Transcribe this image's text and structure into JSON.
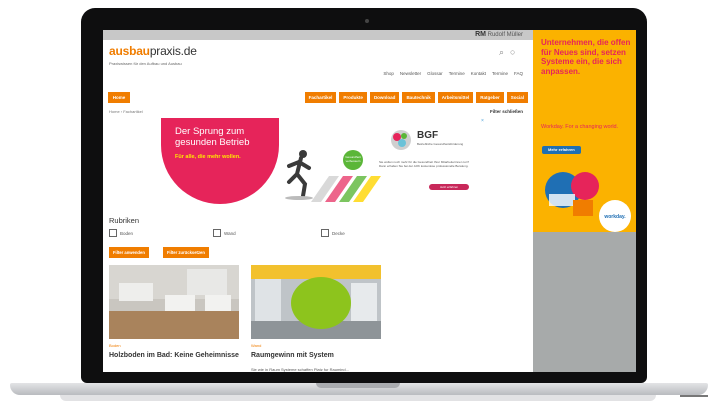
{
  "site": {
    "brand_badge": "RM",
    "brand_badge_sub": "Rudolf Müller",
    "logo_part1": "ausbau",
    "logo_part2": "praxis.de",
    "tagline": "Praxiswissen für den Aufbau und Ausbau",
    "util_nav": [
      "Shop",
      "Newsletter",
      "Glossar",
      "Termine",
      "Kontakt",
      "Termine",
      "FAQ"
    ],
    "nav_home": "Home",
    "nav_items": [
      "Fachartikel",
      "Produkte",
      "Download",
      "Bautechnik",
      "Arbeitsmittel",
      "Ratgeber",
      "Social"
    ],
    "breadcrumb": "Home  ›  Fachartikel",
    "filter_link": "Filter schließen"
  },
  "ad_main": {
    "headline": "Der Sprung zum gesunden Betrieb",
    "sub": "Für alle, die mehr wollen.",
    "badge": "Gesundheit verbessern",
    "bgf_title": "BGF",
    "bgf_sub": "Betriebliche Gesundheitsförderung",
    "bgf_body": "Sie wollen noch mehr für die Gesundheit Ihrer Mitarbeiterinnen tun? Dann erhalten Sie bei der AOK kostenlose professionelle Beratung.",
    "bgf_button": "Jetzt erfahren",
    "close": "×"
  },
  "filters": {
    "heading": "Rubriken",
    "checkboxes": [
      "Boden",
      "Wand",
      "Decke"
    ],
    "apply_button": "Filter anwenden",
    "reset_button": "Filter zurücksetzen"
  },
  "cards": [
    {
      "category": "Boden",
      "title": "Holzboden im Bad: Keine Geheimnisse",
      "teaser": ""
    },
    {
      "category": "Wand",
      "title": "Raumgewinn mit System",
      "teaser": "Sie wie in Raum Systeme schaffen Platz fur Raumind..."
    }
  ],
  "side_ad": {
    "headline": "Unternehmen, die offen für Neues sind, setzen Systeme ein, die sich anpassen.",
    "tag": "Workday. For a changing world.",
    "button": "Mehr erfahren",
    "logo": "workday."
  },
  "colors": {
    "accent": "#f07d00",
    "pink": "#e6245a",
    "yellow": "#fbb200",
    "blue": "#1f6fb4"
  }
}
